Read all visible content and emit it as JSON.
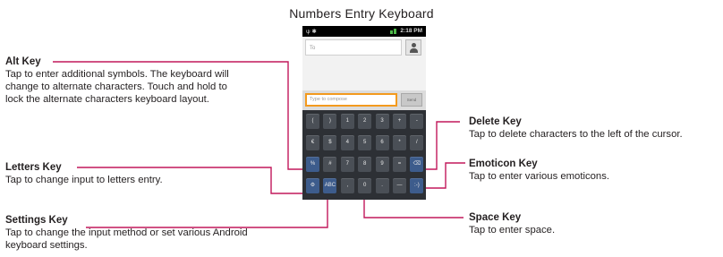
{
  "title": "Numbers Entry Keyboard",
  "labels": {
    "alt": {
      "title": "Alt Key",
      "desc": "Tap to enter additional symbols. The keyboard will change to alternate characters. Touch and hold to lock the alternate characters keyboard layout."
    },
    "letters": {
      "title": "Letters Key",
      "desc": "Tap to change input to letters entry."
    },
    "settings": {
      "title": "Settings Key",
      "desc": "Tap to change the input method or set various Android keyboard settings."
    },
    "delete": {
      "title": "Delete Key",
      "desc": "Tap to delete characters to the left of the cursor."
    },
    "emoticon": {
      "title": "Emoticon Key",
      "desc": "Tap to enter various emoticons."
    },
    "space": {
      "title": "Space Key",
      "desc": "Tap to enter space."
    }
  },
  "phone": {
    "status_time": "2:18 PM",
    "to_placeholder": "To",
    "compose_placeholder": "Type to compose",
    "send_label": "Send",
    "keys": [
      [
        "(",
        ")",
        "1",
        "2",
        "3",
        "+",
        "-"
      ],
      [
        "€",
        "$",
        "4",
        "5",
        "6",
        "*",
        "/"
      ],
      [
        "%",
        "#",
        "7",
        "8",
        "9",
        "=",
        "⌫"
      ],
      [
        "⚙",
        "ABC",
        ",",
        "0",
        ".",
        "—",
        ":-)"
      ]
    ]
  },
  "colors": {
    "connector": "#c2185b",
    "keyboard": "#2d3035",
    "key": "#4a4f56",
    "compose_border": "#f39a1e"
  }
}
